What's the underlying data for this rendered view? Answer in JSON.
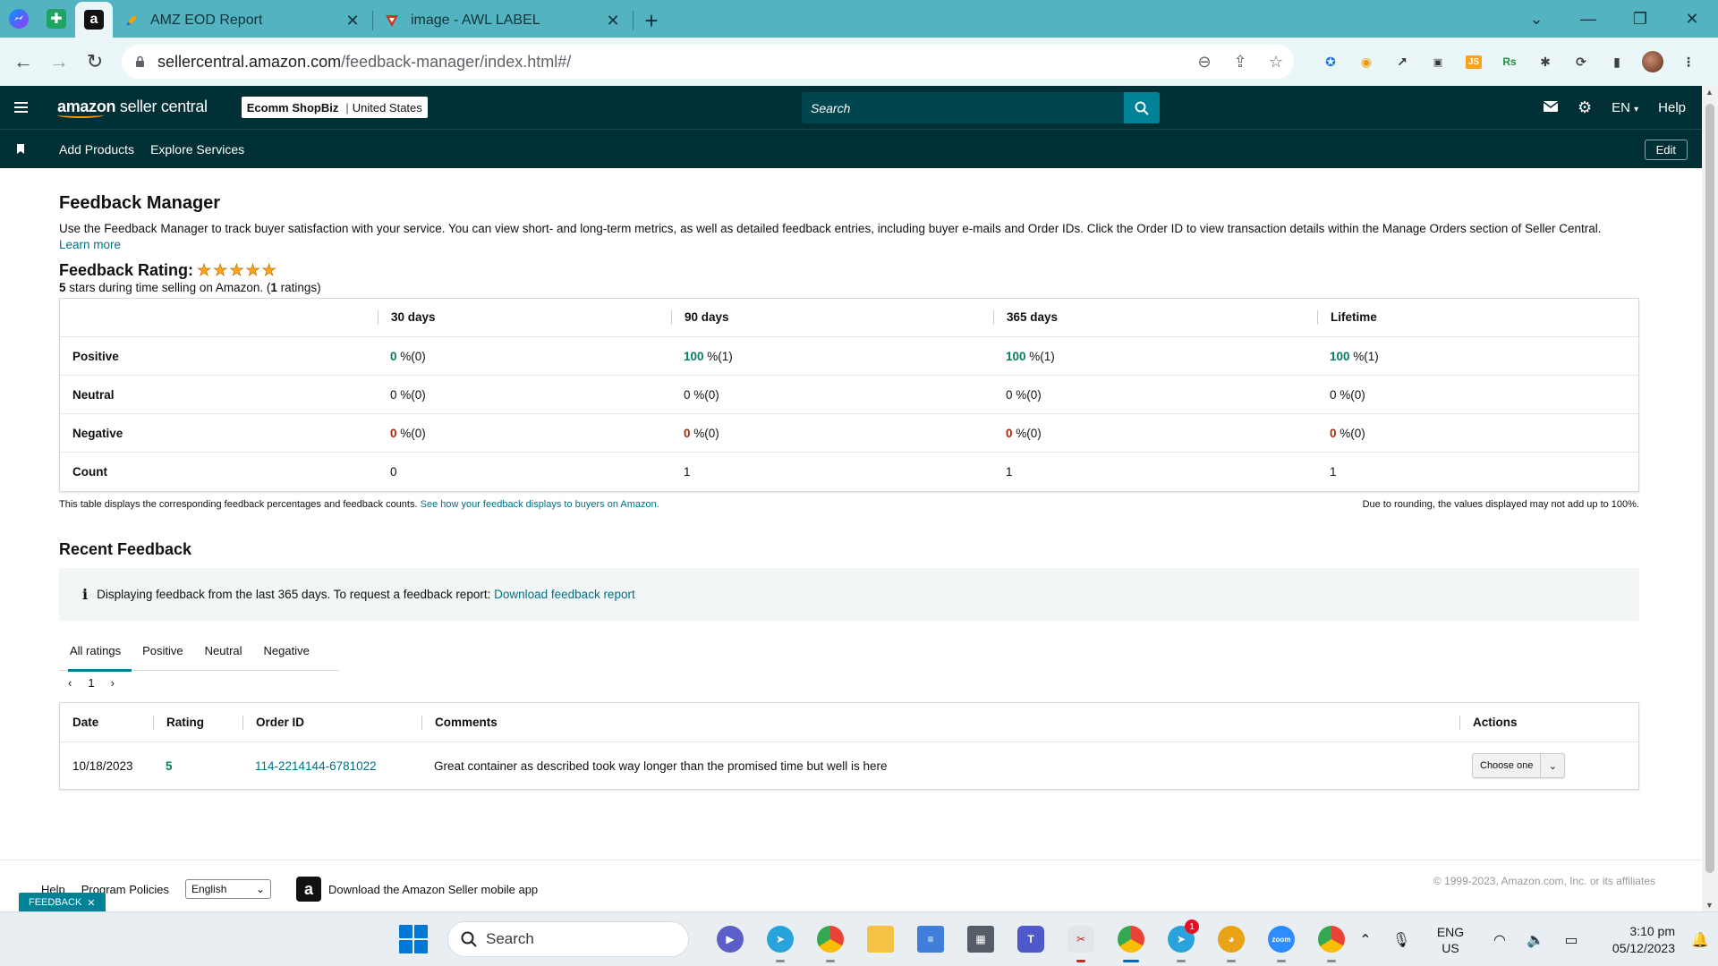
{
  "browser": {
    "tabs": [
      {
        "title": "AMZ EOD Report"
      },
      {
        "title": "image - AWL LABEL"
      }
    ],
    "url_domain": "sellercentral.amazon.com",
    "url_path": "/feedback-manager/index.html#/"
  },
  "header": {
    "logo_a": "amazon",
    "logo_b": " seller central",
    "store_name": "Ecomm ShopBiz",
    "store_region": "United States",
    "search_placeholder": "Search",
    "lang": "EN",
    "help": "Help"
  },
  "nav": {
    "items": [
      "Add Products",
      "Explore Services"
    ],
    "edit": "Edit"
  },
  "page": {
    "title": "Feedback Manager",
    "intro": "Use the Feedback Manager to track buyer satisfaction with your service. You can view short- and long-term metrics, as well as detailed feedback entries, including buyer e-mails and Order IDs. Click the Order ID to view transaction details within the Manage Orders section of Seller Central.",
    "learn_more": "Learn more",
    "rating_label": "Feedback Rating:",
    "rating_stars": 5,
    "rating_sub_stars": "5",
    "rating_sub_text_a": " stars during time selling on Amazon. (",
    "rating_sub_count": "1",
    "rating_sub_text_b": " ratings)"
  },
  "feedback_table": {
    "columns": [
      "",
      "30 days",
      "90 days",
      "365 days",
      "Lifetime"
    ],
    "rows": [
      {
        "label": "Positive",
        "cells": [
          {
            "v": "0",
            "s": " %(0)"
          },
          {
            "v": "100",
            "s": " %(1)"
          },
          {
            "v": "100",
            "s": " %(1)"
          },
          {
            "v": "100",
            "s": " %(1)"
          }
        ]
      },
      {
        "label": "Neutral",
        "cells": [
          {
            "v": "0",
            "s": " %(0)"
          },
          {
            "v": "0",
            "s": " %(0)"
          },
          {
            "v": "0",
            "s": " %(0)"
          },
          {
            "v": "0",
            "s": " %(0)"
          }
        ]
      },
      {
        "label": "Negative",
        "cells": [
          {
            "v": "0",
            "s": " %(0)"
          },
          {
            "v": "0",
            "s": " %(0)"
          },
          {
            "v": "0",
            "s": " %(0)"
          },
          {
            "v": "0",
            "s": " %(0)"
          }
        ]
      },
      {
        "label": "Count",
        "cells": [
          {
            "v": "0",
            "s": ""
          },
          {
            "v": "1",
            "s": ""
          },
          {
            "v": "1",
            "s": ""
          },
          {
            "v": "1",
            "s": ""
          }
        ]
      }
    ],
    "note_left": "This table displays the corresponding feedback percentages and feedback counts.",
    "note_link": "See how your feedback displays to buyers on Amazon.",
    "note_right": "Due to rounding, the values displayed may not add up to 100%."
  },
  "recent": {
    "title": "Recent Feedback",
    "info_text": "Displaying feedback from the last 365 days. To request a feedback report:",
    "info_link": "Download feedback report",
    "tabs": [
      "All ratings",
      "Positive",
      "Neutral",
      "Negative"
    ],
    "page": "1",
    "columns": [
      "Date",
      "Rating",
      "Order ID",
      "Comments",
      "Actions"
    ],
    "rows": [
      {
        "date": "10/18/2023",
        "rating": "5",
        "order_id": "114-2214144-6781022",
        "comment": "Great container as described took way longer than the promised time but well is here",
        "action": "Choose one"
      }
    ]
  },
  "footer": {
    "help": "Help",
    "policies": "Program Policies",
    "language": "English",
    "app_text": "Download the Amazon Seller mobile app",
    "copyright": "© 1999-2023, Amazon.com, Inc. or its affiliates",
    "feedback_tag": "FEEDBACK"
  },
  "taskbar": {
    "search": "Search",
    "lang_top": "ENG",
    "lang_bottom": "US",
    "time": "3:10 pm",
    "date": "05/12/2023",
    "telegram_badge": "1"
  },
  "colors": {
    "tabstrip": "#53b3c1",
    "sc_header": "#002f36",
    "search_button": "#008296",
    "positive_green": "#067d62",
    "negative_red": "#b12704",
    "link": "#007185",
    "star": "#ffa41c"
  }
}
